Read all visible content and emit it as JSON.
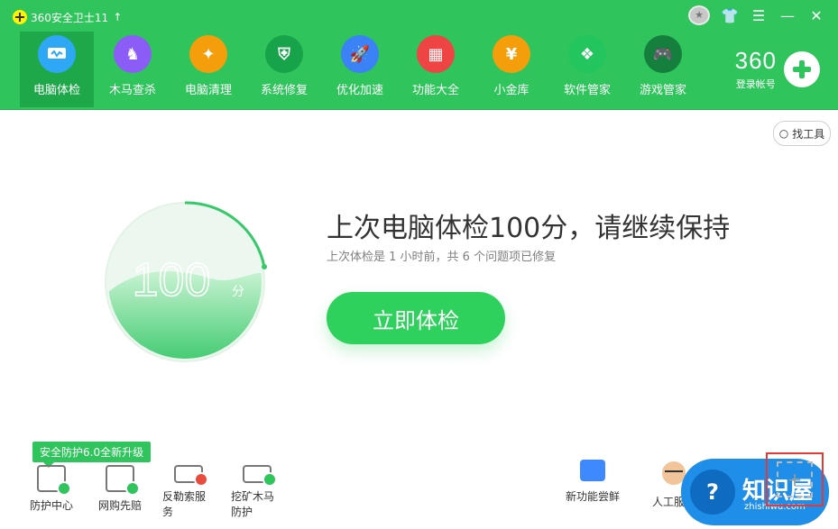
{
  "app": {
    "title": "360安全卫士11",
    "update_arrow": "↑"
  },
  "window": {
    "medal": "★",
    "skin": "👕",
    "menu": "☰",
    "minimize": "—",
    "close": "✕"
  },
  "nav": [
    {
      "label": "电脑体检",
      "icon": "monitor-icon",
      "color": "#2ea8f4"
    },
    {
      "label": "木马查杀",
      "icon": "horse-icon",
      "color": "#8b5cf6"
    },
    {
      "label": "电脑清理",
      "icon": "broom-icon",
      "color": "#f59e0b"
    },
    {
      "label": "系统修复",
      "icon": "shield-icon",
      "color": "#16a34a"
    },
    {
      "label": "优化加速",
      "icon": "rocket-icon",
      "color": "#3b82f6"
    },
    {
      "label": "功能大全",
      "icon": "grid-icon",
      "color": "#ef4444"
    },
    {
      "label": "小金库",
      "icon": "coin-icon",
      "color": "#f59e0b"
    },
    {
      "label": "软件管家",
      "icon": "software-icon",
      "color": "#22c55e"
    },
    {
      "label": "游戏管家",
      "icon": "gamepad-icon",
      "color": "#15803d"
    }
  ],
  "brand": {
    "logo_text": "360",
    "login": "登录帐号"
  },
  "search": {
    "label": "找工具"
  },
  "score": {
    "value": "100",
    "unit": "分",
    "percent": 100
  },
  "main": {
    "title": "上次电脑体检100分，请继续保持",
    "subtitle": "上次体检是 1 小时前，共 6 个问题项已修复",
    "action": "立即体检"
  },
  "tooltip": "安全防护6.0全新升级",
  "bottom_left": [
    "防护中心",
    "网购先赔",
    "反勒索服务",
    "挖矿木马防护"
  ],
  "bottom_right": [
    "新功能尝鲜",
    "人工服务"
  ],
  "watermark": {
    "mark": "?",
    "title": "知识屋",
    "domain": "zhishiwu.com"
  },
  "add_tile": "+"
}
